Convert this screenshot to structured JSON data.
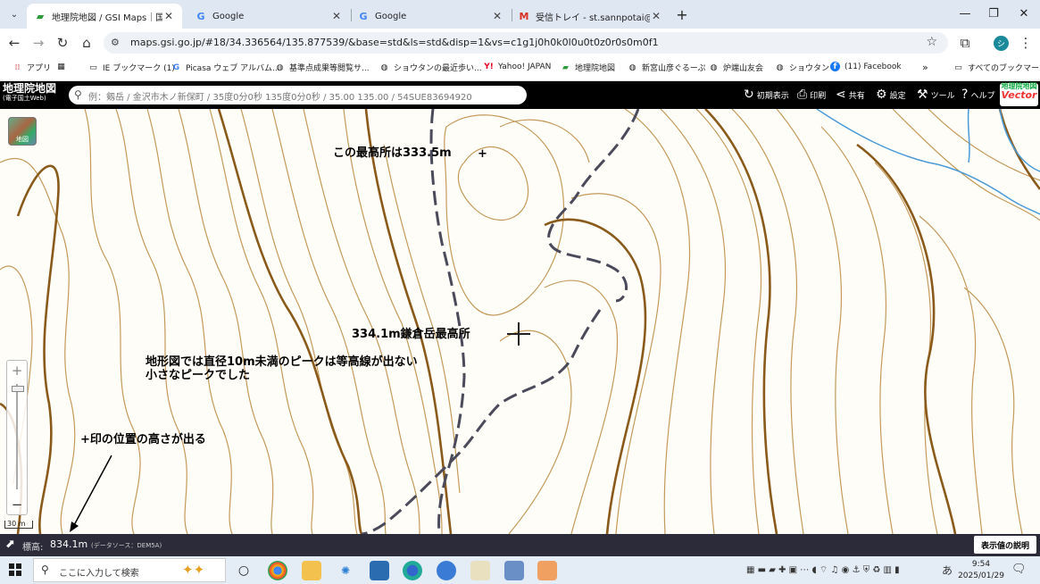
{
  "browser": {
    "tabs": [
      {
        "title": "地理院地図 / GSI Maps｜国土地",
        "active": true
      },
      {
        "title": "Google",
        "active": false
      },
      {
        "title": "Google",
        "active": false
      },
      {
        "title": "受信トレイ - st.sannpotai@gmail",
        "active": false
      }
    ],
    "url": "maps.gsi.go.jp/#18/34.336564/135.877539/&base=std&ls=std&disp=1&vs=c1g1j0h0k0l0u0t0z0r0s0m0f1",
    "profile_initial": "シ"
  },
  "bookmarks": [
    {
      "label": "アプリ",
      "icon": "apps-grid-icon"
    },
    {
      "label": "",
      "icon": "grid-icon"
    },
    {
      "label": "IE ブックマーク (1)",
      "icon": "folder-icon"
    },
    {
      "label": "Picasa ウェブ アルバム...",
      "icon": "google-icon"
    },
    {
      "label": "基準点成果等閲覧サ...",
      "icon": "globe-icon"
    },
    {
      "label": "ショウタンの最近歩い...",
      "icon": "globe-icon"
    },
    {
      "label": "Yahoo! JAPAN",
      "icon": "yahoo-icon"
    },
    {
      "label": "地理院地図",
      "icon": "gsi-icon"
    },
    {
      "label": "新宮山彦ぐるーぷ",
      "icon": "globe-icon"
    },
    {
      "label": "炉端山友会",
      "icon": "globe-icon"
    },
    {
      "label": "ショウタン",
      "icon": "globe-icon"
    },
    {
      "label": "(11) Facebook",
      "icon": "facebook-icon"
    }
  ],
  "bookmarks_more": "»",
  "bookmarks_all": "すべてのブックマーク",
  "gsi": {
    "logo_title": "地理院地図",
    "logo_sub": "(電子国土Web)",
    "search_placeholder": "例：剱岳 / 金沢市木ノ新保町 / 35度0分0秒 135度0分0秒 / 35.00 135.00 / 54SUE83694920",
    "buttons": {
      "initial_view": "初期表示",
      "print": "印刷",
      "share": "共有",
      "settings": "設定",
      "tools": "ツール",
      "help": "ヘルプ"
    },
    "vector_logo_top": "地理院地図",
    "vector_logo_bottom": "Vector"
  },
  "map": {
    "layer_button_label": "地図",
    "annotations": {
      "highest_point_note": "この最高所は333.5m",
      "summit_label": "334.1m鎌倉岳最高所",
      "contour_note_line1": "地形図では直径10m未満のピークは等高線が出ない",
      "contour_note_line2": "小さなピークでした",
      "crosshair_note": "+印の位置の高さが出る",
      "small_plus": "+"
    },
    "zoom": {
      "in": "+",
      "out": "−"
    },
    "scale_label": "30 m"
  },
  "elevation": {
    "label": "標高:",
    "value": "834.1m",
    "source": "(データソース：DEM5A)",
    "explain_button": "表示値の説明"
  },
  "taskbar": {
    "search_placeholder": "ここに入力して検索",
    "time": "9:54",
    "date": "2025/01/29",
    "ime": "あ"
  },
  "colors": {
    "contour_index": "#8a5a1a",
    "contour_minor": "#c49a5a",
    "trail": "#4a4a5a",
    "stream": "#4a9ad8",
    "header_bg": "#000000",
    "elev_bar_bg": "#2b2b3a"
  }
}
